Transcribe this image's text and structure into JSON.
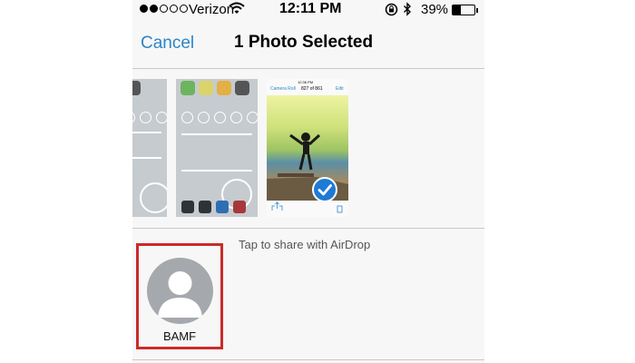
{
  "status_bar": {
    "signal_filled": 2,
    "signal_total": 5,
    "carrier": "Verizon",
    "time": "12:11 PM",
    "battery_percent": "39%",
    "battery_level": 0.39,
    "icons": [
      "wifi-icon",
      "rotation-lock-icon",
      "bluetooth-icon",
      "battery-icon"
    ]
  },
  "nav": {
    "cancel_label": "Cancel",
    "title": "1 Photo Selected"
  },
  "photos": {
    "selected_count": 1,
    "mini": {
      "status_time": "12:36 PM",
      "back_label": "Camera Roll",
      "count_text": "827 of 861",
      "edit_label": "Edit"
    }
  },
  "airdrop": {
    "hint": "Tap to share with AirDrop",
    "contacts": [
      {
        "name": "BAMF",
        "icon": "person-avatar-icon"
      }
    ]
  },
  "colors": {
    "accent": "#2c86c7",
    "highlight_border": "#cc2a2a",
    "checkmark": "#1f7ad6"
  }
}
